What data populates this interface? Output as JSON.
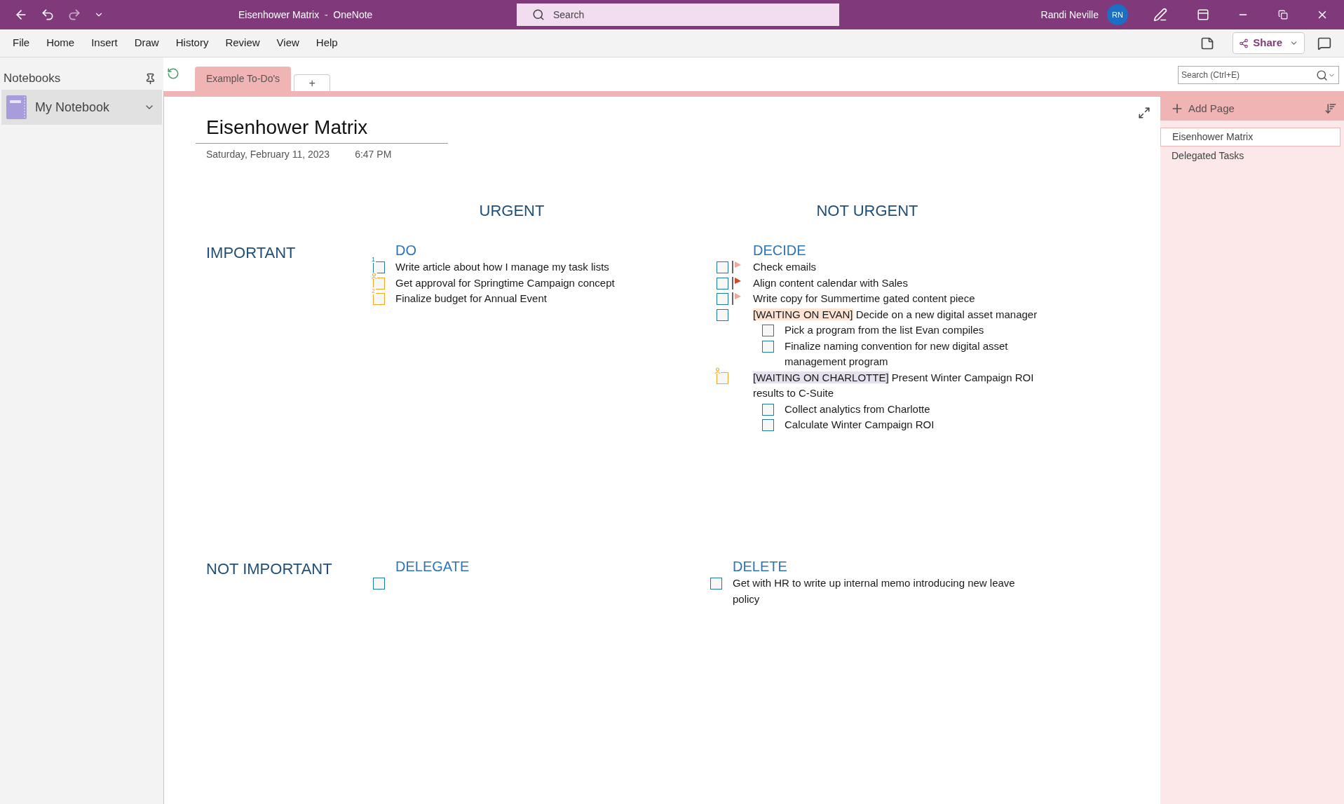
{
  "title_bar": {
    "title": "Eisenhower Matrix  -  OneNote",
    "search_placeholder": "Search",
    "user_name": "Randi Neville",
    "user_initials": "RN"
  },
  "menu": [
    {
      "label": "File"
    },
    {
      "label": "Home"
    },
    {
      "label": "Insert"
    },
    {
      "label": "Draw"
    },
    {
      "label": "History"
    },
    {
      "label": "Review"
    },
    {
      "label": "View"
    },
    {
      "label": "Help"
    }
  ],
  "share": "Share",
  "sidebar": {
    "heading": "Notebooks",
    "notebook": "My Notebook"
  },
  "sections": [
    {
      "label": "Example To-Do's",
      "selected": true
    }
  ],
  "new_section": "+",
  "page_search": {
    "placeholder": "Search (Ctrl+E)"
  },
  "page_list": {
    "add_page": "Add Page",
    "pages": [
      {
        "title": "Eisenhower Matrix",
        "selected": true
      },
      {
        "title": "Delegated Tasks",
        "selected": false
      }
    ]
  },
  "page": {
    "title": "Eisenhower Matrix",
    "date": "Saturday, February 11, 2023",
    "time": "6:47 PM",
    "column_headers": [
      "URGENT",
      "NOT URGENT"
    ],
    "row_headers": [
      "IMPORTANT",
      "NOT IMPORTANT"
    ],
    "quadrants": [
      {
        "heading": "DO",
        "tasks": [
          {
            "kind": "numbered",
            "tag": "1",
            "color": "#1e7ba6",
            "text": "Write article about how I manage my task lists"
          },
          {
            "kind": "contact",
            "color": "#f5a623",
            "text": "Get approval for Springtime Campaign concept"
          },
          {
            "kind": "numbered",
            "tag": "2",
            "color": "#f5a623",
            "text": "Finalize budget for Annual Event"
          }
        ]
      },
      {
        "heading": "DECIDE",
        "tasks": [
          {
            "kind": "todo",
            "color": "#1e7ba6",
            "flag": {
              "color": "#f0a49a"
            },
            "text": "Check emails"
          },
          {
            "kind": "todo",
            "color": "#1e7ba6",
            "flag": {
              "color": "#d24726"
            },
            "text": "Align content calendar with Sales"
          },
          {
            "kind": "todo",
            "color": "#1e7ba6",
            "flag": {
              "color": "#f0a49a"
            },
            "text": "Write copy for Summertime gated content piece"
          },
          {
            "kind": "todo",
            "color": "#1e7ba6",
            "label": {
              "text": "[WAITING ON EVAN]",
              "color": "#fde4d4"
            },
            "text": "Decide on a new digital asset manager",
            "children": [
              {
                "kind": "todo",
                "color": "#1e7ba6",
                "text": "Pick a program from the list Evan compiles"
              },
              {
                "kind": "todo",
                "color": "#1e7ba6",
                "text": "Finalize naming convention for new digital asset management program"
              }
            ]
          },
          {
            "kind": "contact",
            "color": "#f5a623",
            "label": {
              "text": "[WAITING ON CHARLOTTE]",
              "color": "#e6e1ee"
            },
            "text": "Present Winter Campaign ROI results to C-Suite",
            "children": [
              {
                "kind": "todo",
                "color": "#1e7ba6",
                "text": "Collect analytics from Charlotte"
              },
              {
                "kind": "todo",
                "color": "#1e7ba6",
                "text": "Calculate Winter Campaign ROI"
              }
            ]
          }
        ]
      },
      {
        "heading": "DELEGATE",
        "tasks": [
          {
            "kind": "todo",
            "color": "#1e7ba6"
          }
        ]
      },
      {
        "heading": "DELETE",
        "tasks": [
          {
            "kind": "todo",
            "color": "#1e7ba6",
            "text": "Get with HR to write up internal memo introducing new leave policy"
          }
        ]
      }
    ]
  }
}
